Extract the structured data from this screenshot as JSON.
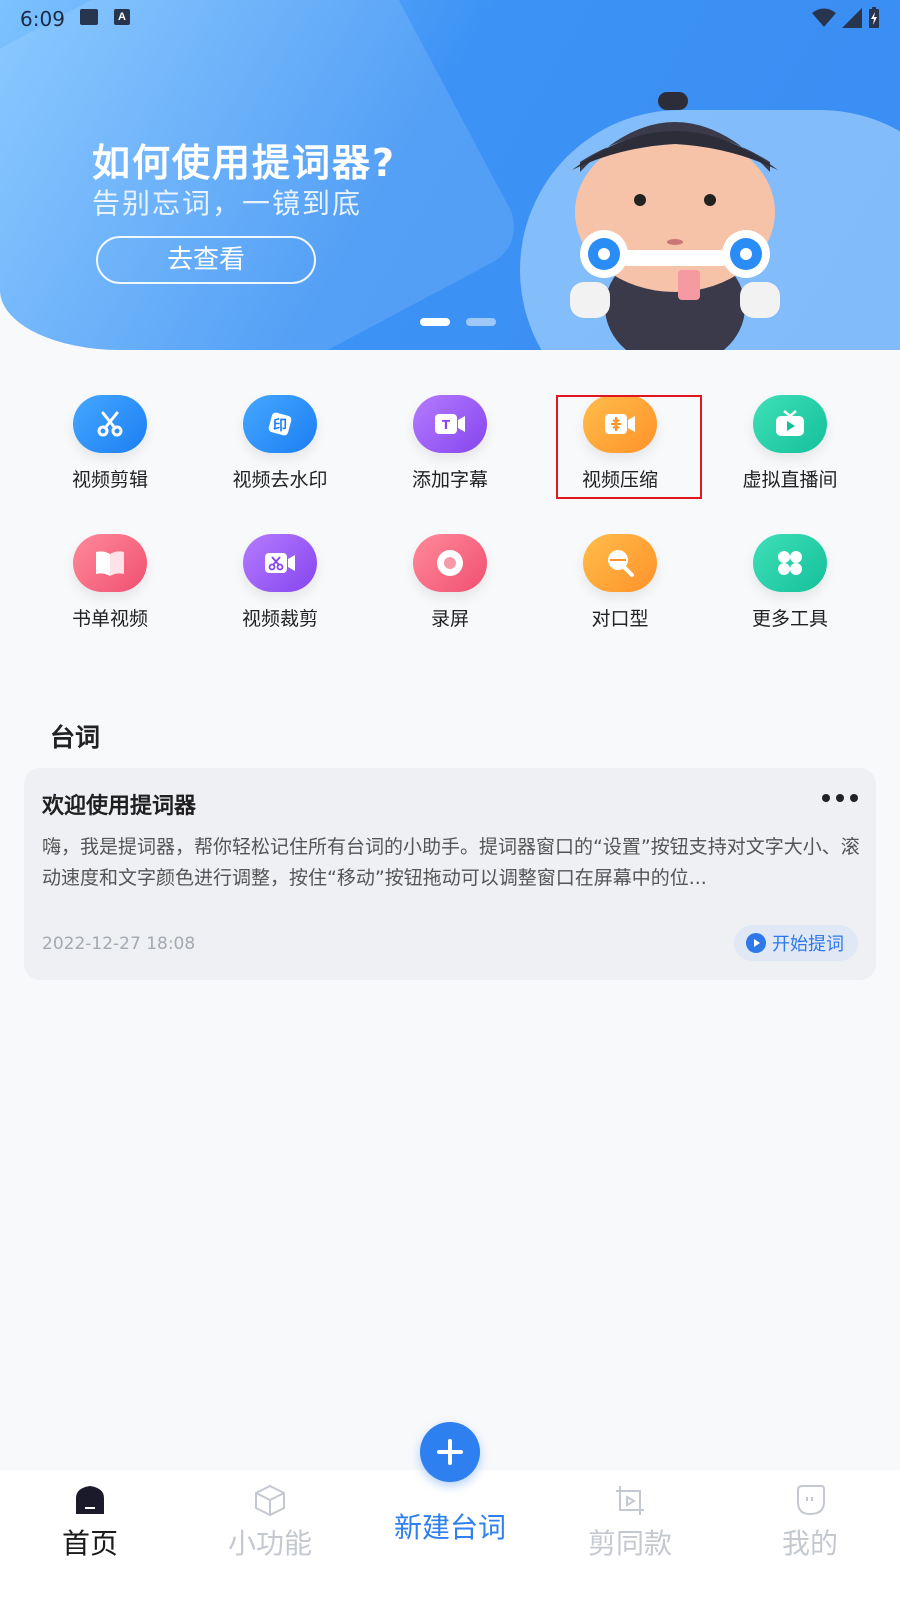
{
  "status_bar": {
    "time": "6:09",
    "a_icon_text": "A"
  },
  "banner": {
    "title": "如何使用提词器?",
    "subtitle": "告别忘词，一镜到底",
    "button_label": "去查看"
  },
  "tools": [
    {
      "label": "视频剪辑",
      "icon": "scissors-icon",
      "color": "#2a8cf5"
    },
    {
      "label": "视频去水印",
      "icon": "watermark-remove-icon",
      "color": "#2a8cf5"
    },
    {
      "label": "添加字幕",
      "icon": "subtitle-icon",
      "color": "#9a58f2"
    },
    {
      "label": "视频压缩",
      "icon": "compress-icon",
      "color": "#ffa53a"
    },
    {
      "label": "虚拟直播间",
      "icon": "tv-live-icon",
      "color": "#22cca4"
    },
    {
      "label": "书单视频",
      "icon": "book-icon",
      "color": "#f56a80"
    },
    {
      "label": "视频裁剪",
      "icon": "crop-video-icon",
      "color": "#9a58f2"
    },
    {
      "label": "录屏",
      "icon": "record-icon",
      "color": "#f56a80"
    },
    {
      "label": "对口型",
      "icon": "lipsync-icon",
      "color": "#ffa53a"
    },
    {
      "label": "更多工具",
      "icon": "more-tools-icon",
      "color": "#22cca4"
    }
  ],
  "section": {
    "title": "台词"
  },
  "script_card": {
    "title": "欢迎使用提词器",
    "content": "嗨，我是提词器，帮你轻松记住所有台词的小助手。提词器窗口的“设置”按钮支持对文字大小、滚动速度和文字颜色进行调整，按住“移动”按钮拖动可以调整窗口在屏幕中的位...",
    "date": "2022-12-27 18:08",
    "start_label": "开始提词"
  },
  "bottom_nav": {
    "items": [
      {
        "label": "首页",
        "icon": "home-icon"
      },
      {
        "label": "小功能",
        "icon": "cube-icon"
      },
      {
        "label": "新建台词",
        "icon": "plus-icon"
      },
      {
        "label": "剪同款",
        "icon": "template-icon"
      },
      {
        "label": "我的",
        "icon": "profile-icon"
      }
    ]
  }
}
